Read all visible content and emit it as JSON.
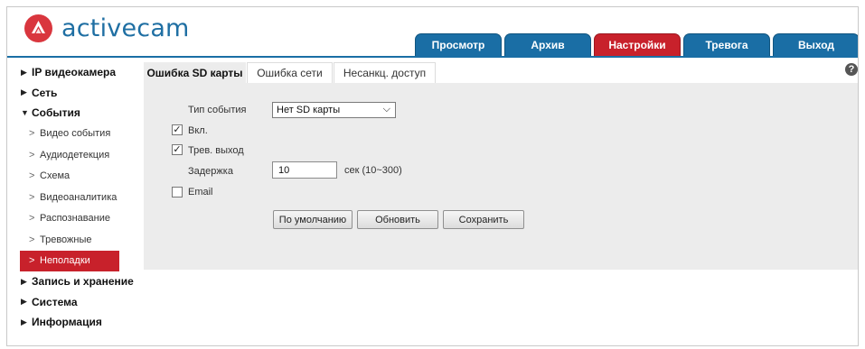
{
  "brand": {
    "name": "activecam",
    "logo_color": "#d9363e",
    "text_color": "#1f6fa3"
  },
  "nav": {
    "items": [
      {
        "label": "Просмотр",
        "active": false
      },
      {
        "label": "Архив",
        "active": false
      },
      {
        "label": "Настройки",
        "active": true
      },
      {
        "label": "Тревога",
        "active": false
      },
      {
        "label": "Выход",
        "active": false
      }
    ],
    "color": "#1a6ea5",
    "active_color": "#c8212b"
  },
  "sidebar": {
    "sections": [
      {
        "label": "IP видеокамера",
        "expanded": false
      },
      {
        "label": "Сеть",
        "expanded": false
      },
      {
        "label": "События",
        "expanded": true
      },
      {
        "label": "Запись и хранение",
        "expanded": false
      },
      {
        "label": "Система",
        "expanded": false
      },
      {
        "label": "Информация",
        "expanded": false
      }
    ],
    "events_items": [
      {
        "label": "Видео события",
        "active": false
      },
      {
        "label": "Аудиодетекция",
        "active": false
      },
      {
        "label": "Схема",
        "active": false
      },
      {
        "label": "Видеоаналитика",
        "active": false
      },
      {
        "label": "Распознавание",
        "active": false
      },
      {
        "label": "Тревожные",
        "active": false
      },
      {
        "label": "Неполадки",
        "active": true
      }
    ],
    "collapsed_glyph": "▶",
    "expanded_glyph": "▼",
    "chevron_glyph": ">"
  },
  "tabs": [
    {
      "label": "Ошибка SD карты",
      "active": true
    },
    {
      "label": "Ошибка сети",
      "active": false
    },
    {
      "label": "Несанкц. доступ",
      "active": false
    }
  ],
  "help_icon": "?",
  "form": {
    "event_type_label": "Тип события",
    "event_type_value": "Нет SD карты",
    "enable_label": "Вкл.",
    "enable_checked": true,
    "alarm_out_label": "Трев. выход",
    "alarm_out_checked": true,
    "delay_label": "Задержка",
    "delay_value": "10",
    "delay_unit": "сек (10~300)",
    "email_label": "Email",
    "email_checked": false,
    "check_glyph": "✓",
    "dropdown_glyph": "⌵"
  },
  "buttons": {
    "default_label": "По умолчанию",
    "refresh_label": "Обновить",
    "save_label": "Сохранить"
  }
}
